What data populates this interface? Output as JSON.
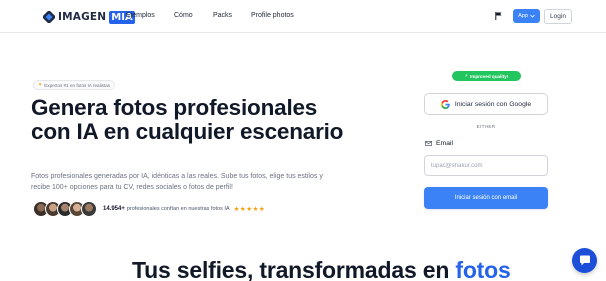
{
  "nav": {
    "logo_text": "IMAGEN",
    "logo_badge": "MIA",
    "links": [
      "Ejemplos",
      "Cómo",
      "Packs",
      "Profile photos"
    ],
    "app_label": "App",
    "login_label": "Login"
  },
  "hero": {
    "badge": "Expertos #1 en fotos IA realistas",
    "title": "Genera fotos profesionales con IA en cualquier escenario",
    "description": "Fotos profesionales generadas por IA, idénticas a las reales. Sube tus fotos, elige tus estilos y recibe 100+ opciones para tu CV, redes sociales o fotos de perfil!",
    "proof_count": "14.954+",
    "proof_text": "profesionales confían en nuestras fotos IA",
    "stars": "★★★★★"
  },
  "auth": {
    "quality_pill": "Improved quality!",
    "google_label": "Iniciar sesión con Google",
    "divider": "EITHER",
    "email_label": "Email",
    "email_placeholder": "tupac@shakur.com",
    "email_button": "Iniciar sesión con email"
  },
  "section": {
    "title_main": "Tus selfies, transformadas en ",
    "title_accent": "fotos"
  },
  "colors": {
    "primary": "#3b82f6",
    "accent": "#2563eb",
    "success": "#22c55e",
    "star": "#f59e0b"
  }
}
